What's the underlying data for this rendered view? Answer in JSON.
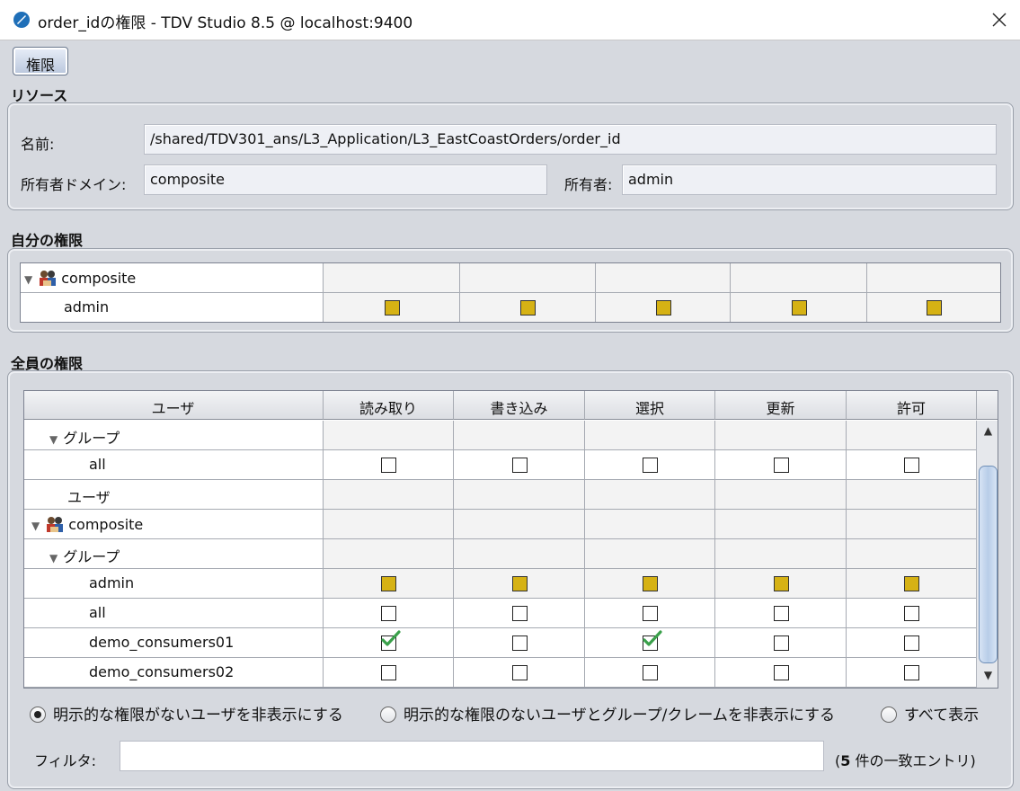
{
  "window": {
    "title": "order_idの権限 - TDV Studio 8.5 @ localhost:9400"
  },
  "tabs": [
    {
      "label": "権限",
      "selected": true
    }
  ],
  "resource": {
    "section_title": "リソース",
    "name_label": "名前:",
    "name_value": "/shared/TDV301_ans/L3_Application/L3_EastCoastOrders/order_id",
    "owner_domain_label": "所有者ドメイン:",
    "owner_domain_value": "composite",
    "owner_label": "所有者:",
    "owner_value": "admin"
  },
  "my_permissions": {
    "section_title": "自分の権限",
    "rows": [
      {
        "label": "composite",
        "type": "domain",
        "expanded": true,
        "cells": [
          null,
          null,
          null,
          null,
          null
        ]
      },
      {
        "label": "admin",
        "type": "user",
        "cells": [
          "granted",
          "granted",
          "granted",
          "granted",
          "granted"
        ]
      }
    ]
  },
  "all_permissions": {
    "section_title": "全員の権限",
    "columns": [
      "ユーザ",
      "読み取り",
      "書き込み",
      "選択",
      "更新",
      "許可"
    ],
    "rows": [
      {
        "label": "グループ",
        "type": "group-header",
        "expanded": true,
        "cells": [
          null,
          null,
          null,
          null,
          null
        ]
      },
      {
        "label": "all",
        "type": "item",
        "cells": [
          "empty",
          "empty",
          "empty",
          "empty",
          "empty"
        ]
      },
      {
        "label": "ユーザ",
        "type": "header",
        "cells": [
          null,
          null,
          null,
          null,
          null
        ]
      },
      {
        "label": "composite",
        "type": "domain",
        "expanded": true,
        "cells": [
          null,
          null,
          null,
          null,
          null
        ]
      },
      {
        "label": "グループ",
        "type": "group-header",
        "expanded": true,
        "cells": [
          null,
          null,
          null,
          null,
          null
        ]
      },
      {
        "label": "admin",
        "type": "item",
        "cells": [
          "granted",
          "granted",
          "granted",
          "granted",
          "granted"
        ]
      },
      {
        "label": "all",
        "type": "item",
        "cells": [
          "empty",
          "empty",
          "empty",
          "empty",
          "empty"
        ]
      },
      {
        "label": "demo_consumers01",
        "type": "item",
        "cells": [
          "checked",
          "empty",
          "checked",
          "empty",
          "empty"
        ]
      },
      {
        "label": "demo_consumers02",
        "type": "item",
        "cells": [
          "empty",
          "empty",
          "empty",
          "empty",
          "empty"
        ]
      }
    ]
  },
  "display_options": {
    "options": [
      {
        "label": "明示的な権限がないユーザを非表示にする",
        "selected": true
      },
      {
        "label": "明示的な権限のないユーザとグループ/クレームを非表示にする",
        "selected": false
      },
      {
        "label": "すべて表示",
        "selected": false
      }
    ]
  },
  "filter": {
    "label": "フィルタ:",
    "value": "",
    "match_count": "5",
    "match_prefix": "(",
    "match_suffix": " 件の一致エントリ)"
  },
  "colors": {
    "granted_fill": "#d6b214",
    "check_mark": "#3aa04a",
    "window_bg": "#d6d9df"
  }
}
